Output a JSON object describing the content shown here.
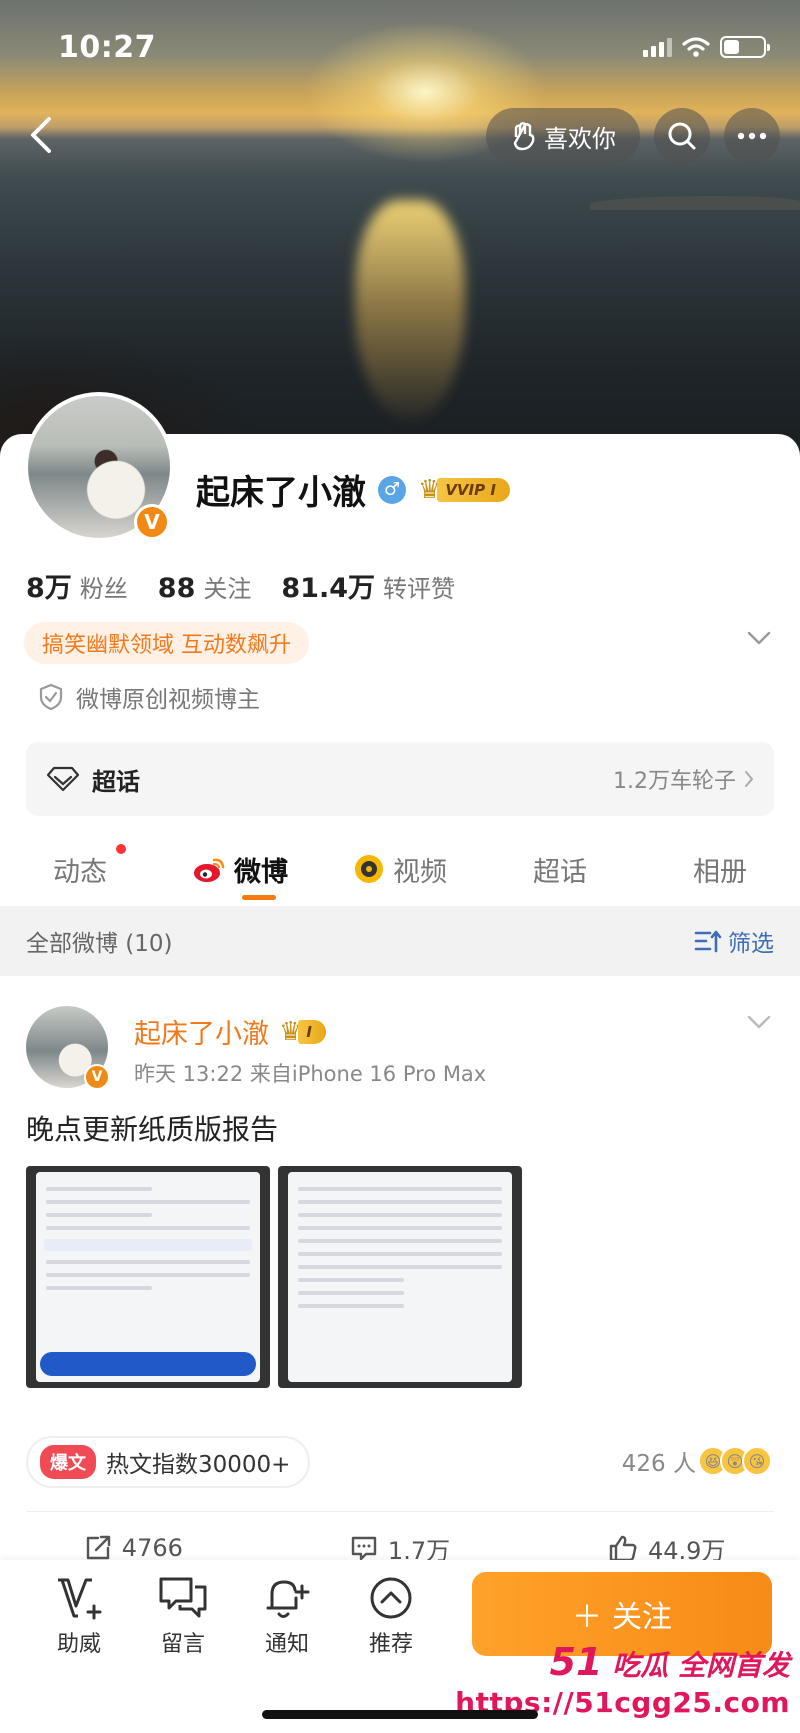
{
  "status": {
    "time": "10:27"
  },
  "header": {
    "like_label": "喜欢你"
  },
  "profile": {
    "name": "起床了小澈",
    "vip_label": "VVIP I",
    "stats": [
      {
        "num": "8万",
        "label": "粉丝"
      },
      {
        "num": "88",
        "label": "关注"
      },
      {
        "num": "81.4万",
        "label": "转评赞"
      }
    ],
    "tag": "搞笑幽默领域 互动数飙升",
    "creator": "微博原创视频博主",
    "super_topic": {
      "title": "超话",
      "count": "1.2万车轮子"
    }
  },
  "tabs": [
    {
      "label": "动态"
    },
    {
      "label": "微博"
    },
    {
      "label": "视频"
    },
    {
      "label": "超话"
    },
    {
      "label": "相册"
    }
  ],
  "filter": {
    "all_label": "全部微博 (10)",
    "filter_label": "筛选"
  },
  "post": {
    "author": "起床了小澈",
    "meta": "昨天 13:22  来自iPhone 16 Pro Max",
    "text": "晚点更新纸质版报告",
    "hot_tag": "爆文",
    "hot_text": "热文指数30000+",
    "reactions": "426 人",
    "repost": "4766",
    "comments": "1.7万",
    "likes": "44.9万"
  },
  "bottom": {
    "items": [
      "助威",
      "留言",
      "通知",
      "推荐"
    ],
    "follow": "关注"
  },
  "watermark": {
    "num": "51",
    "line1": "吃瓜 全网首发",
    "line2": "https://51cgg25.com"
  },
  "colors": {
    "accent": "#f78b16",
    "link": "#3d6fb8",
    "name_orange": "#f07a1a"
  }
}
